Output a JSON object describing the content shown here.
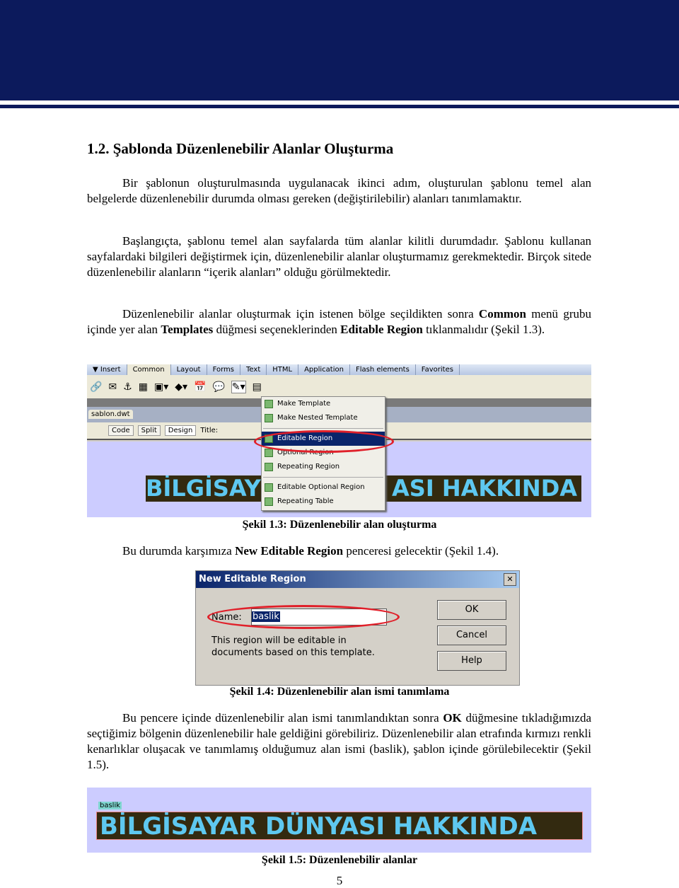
{
  "heading": "1.2. Şablonda Düzenlenebilir Alanlar Oluşturma",
  "paragraphs": [
    "Bir şablonun oluşturulmasında uygulanacak ikinci adım, oluşturulan şablonu temel alan belgelerde düzenlenebilir durumda olması gereken (değiştirilebilir) alanları tanımlamaktır.",
    "Başlangıçta, şablonu temel alan sayfalarda tüm alanlar kilitli durumdadır. Şablonu kullanan sayfalardaki bilgileri değiştirmek için, düzenlenebilir alanlar oluşturmamız gerekmektedir. Birçok sitede düzenlenebilir alanların “içerik alanları” olduğu görülmektedir."
  ],
  "p3": {
    "a": "Düzenlenebilir alanlar oluşturmak için istenen bölge seçildikten sonra ",
    "b1": "Common",
    "c": " menü grubu içinde yer alan ",
    "b2": "Templates",
    "d": " düğmesi seçeneklerinden ",
    "b3": "Editable Region",
    "e": " tıklanmalıdır (Şekil 1.3)."
  },
  "fig1": {
    "tabs": [
      "▼ Insert",
      "Common",
      "Layout",
      "Forms",
      "Text",
      "HTML",
      "Application",
      "Flash elements",
      "Favorites"
    ],
    "doc_tab": "sablon.dwt",
    "view_buttons": [
      "Code",
      "Split",
      "Design"
    ],
    "title_label": "Title:",
    "banner_left": "BİLGİSAY",
    "banner_right": "ASI HAKKINDA",
    "menu": [
      "Make Template",
      "Make Nested Template",
      "Editable Region",
      "Optional Region",
      "Repeating Region",
      "Editable Optional Region",
      "Repeating Table"
    ],
    "caption": "Şekil 1.3: Düzenlenebilir alan oluşturma"
  },
  "p4": {
    "a": "Bu durumda karşımıza ",
    "b": "New Editable Region",
    "c": " penceresi gelecektir (Şekil 1.4)."
  },
  "dialog": {
    "title": "New Editable Region",
    "close": "✕",
    "name_label": "Name:",
    "name_value": "baslik",
    "info": "This region will be editable in documents based on this template.",
    "ok": "OK",
    "cancel": "Cancel",
    "help": "Help",
    "caption": "Şekil 1.4: Düzenlenebilir alan ismi tanımlama"
  },
  "p5": {
    "a": "Bu pencere içinde düzenlenebilir alan ismi tanımlandıktan sonra ",
    "b": "OK",
    "c": " düğmesine tıkladığımızda seçtiğimiz bölgenin düzenlenebilir hale geldiğini görebiliriz. Düzenlenebilir alan etrafında kırmızı renkli kenarlıklar oluşacak ve tanımlamış olduğumuz alan ismi (baslik), şablon içinde görülebilecektir (Şekil 1.5)."
  },
  "fig3": {
    "tag": "baslik",
    "banner": "BİLGİSAYAR DÜNYASI HAKKINDA",
    "caption": "Şekil 1.5: Düzenlenebilir alanlar"
  },
  "page_number": "5",
  "colors": {
    "header": "#0c1a5c",
    "highlight": "#0a246a",
    "oval": "#e0202a",
    "canvas": "#ccccff",
    "banner_bg": "#332a10",
    "banner_text": "#5ec8f0"
  }
}
